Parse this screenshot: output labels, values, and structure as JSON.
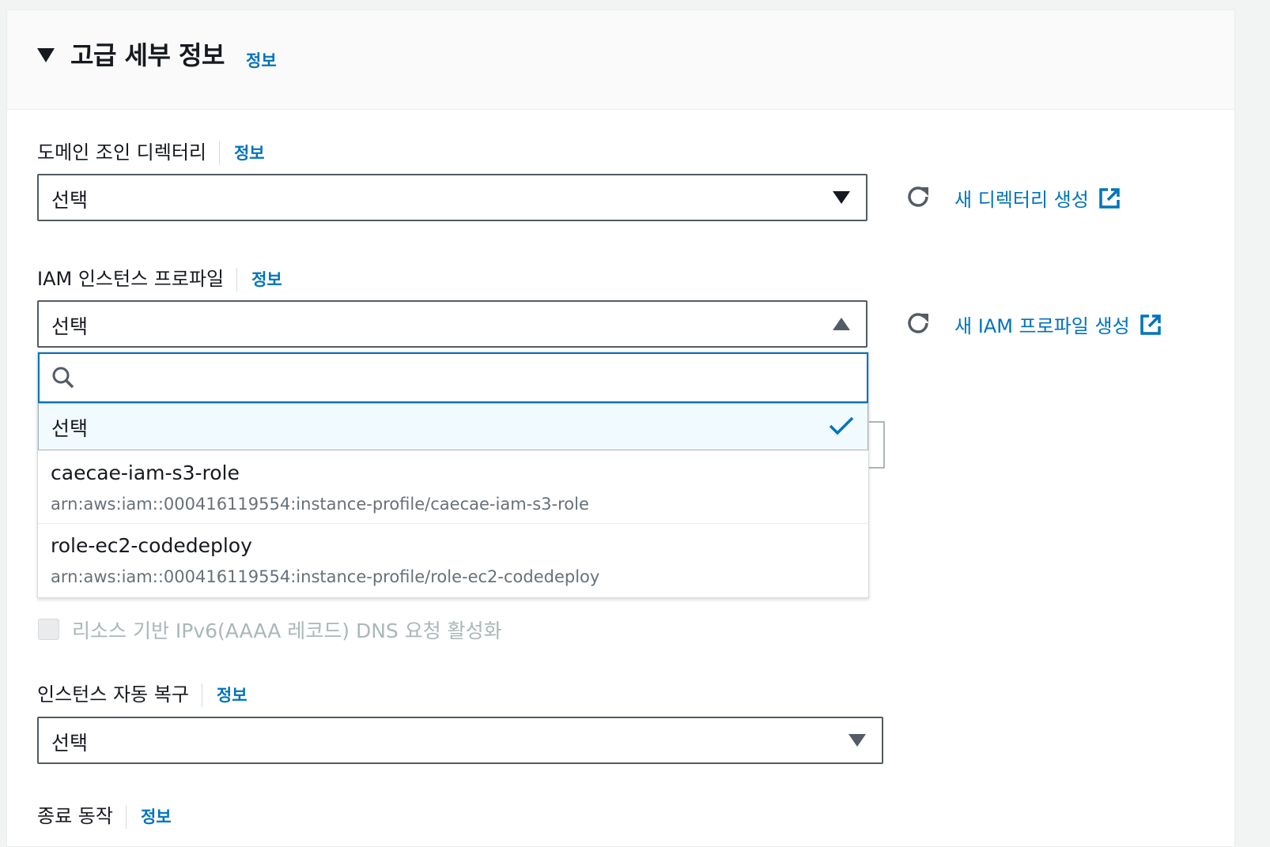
{
  "section": {
    "title": "고급 세부 정보",
    "info": "정보"
  },
  "domain_join": {
    "label": "도메인 조인 디렉터리",
    "info": "정보",
    "value": "선택",
    "create_link": "새 디렉터리 생성"
  },
  "iam_profile": {
    "label": "IAM 인스턴스 프로파일",
    "info": "정보",
    "value": "선택",
    "create_link": "새 IAM 프로파일 생성",
    "search_placeholder": "",
    "options": [
      {
        "label": "선택",
        "selected": true
      },
      {
        "label": "caecae-iam-s3-role",
        "description": "arn:aws:iam::000416119554:instance-profile/caecae-iam-s3-role"
      },
      {
        "label": "role-ec2-codedeploy",
        "description": "arn:aws:iam::000416119554:instance-profile/role-ec2-codedeploy"
      }
    ]
  },
  "dns_checkbox": {
    "label": "리소스 기반 IPv6(AAAA 레코드) DNS 요청 활성화",
    "checked": false,
    "disabled": true
  },
  "auto_recovery": {
    "label": "인스턴스 자동 복구",
    "info": "정보",
    "value": "선택"
  },
  "shutdown_behavior": {
    "label": "종료 동작",
    "info": "정보"
  },
  "colors": {
    "link": "#0073bb",
    "selected_bg": "#f1faff",
    "border": "#545b64"
  }
}
